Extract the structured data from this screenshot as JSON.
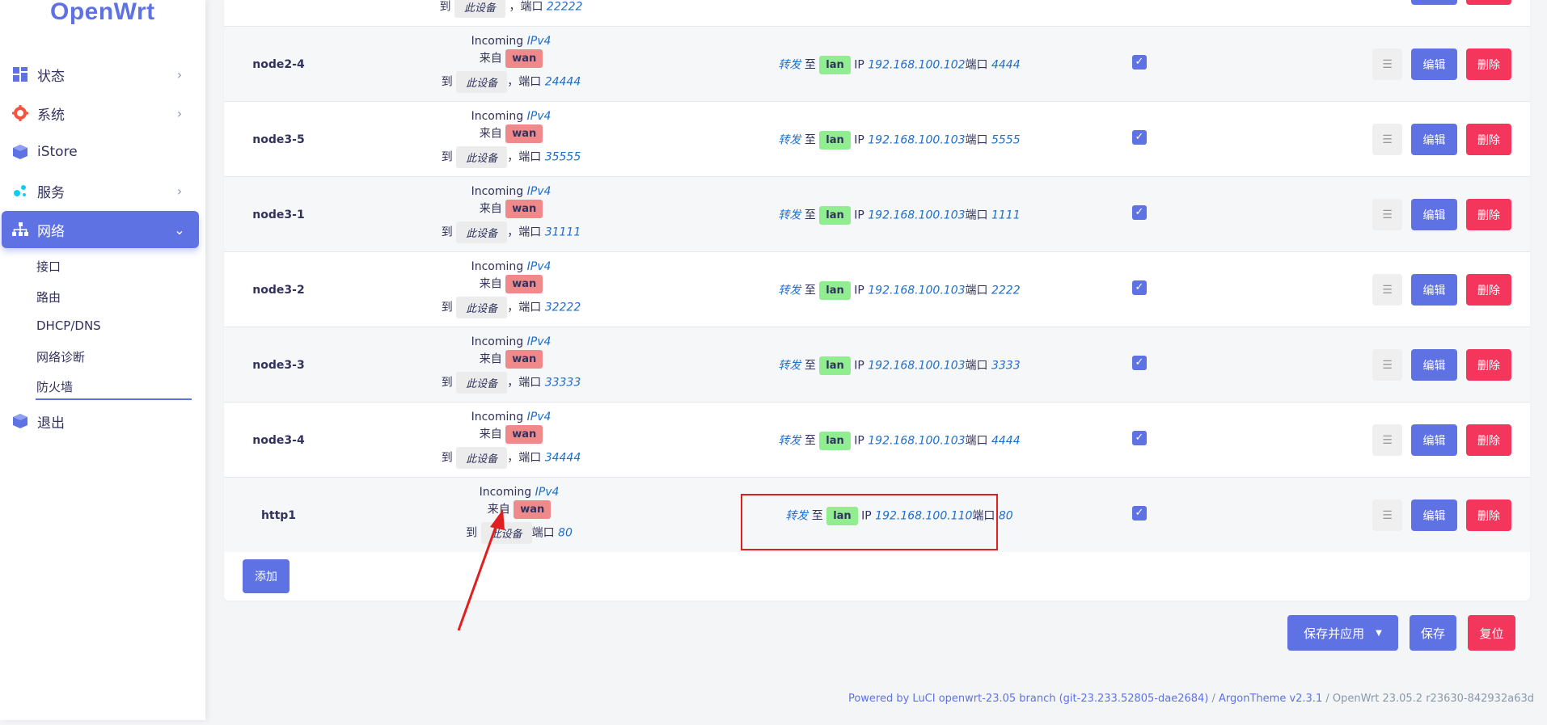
{
  "brand": "OpenWrt",
  "nav": [
    {
      "label": "状态",
      "icon": "dashboard-icon"
    },
    {
      "label": "系统",
      "icon": "gear-icon"
    },
    {
      "label": "iStore",
      "icon": "cube-icon"
    },
    {
      "label": "服务",
      "icon": "cubes-icon"
    },
    {
      "label": "网络",
      "icon": "network-icon"
    }
  ],
  "subnav": [
    "接口",
    "路由",
    "DHCP/DNS",
    "网络诊断",
    "防火墙"
  ],
  "logout": "退出",
  "top_partial": {
    "to": "到",
    "device": "此设备",
    "port_text": "，端口",
    "port": "22222"
  },
  "rows": [
    {
      "name": "node2-4",
      "incoming": "Incoming",
      "ipv": "IPv4",
      "from": "来自",
      "zone": "wan",
      "to": "到",
      "device": "此设备",
      "port_text": "，端口",
      "port": "24444",
      "action": "转发",
      "to2": "至",
      "dst_zone": "lan",
      "ip_text": "IP",
      "ip": "192.168.100.102",
      "dport_text": "端口",
      "dport": "4444"
    },
    {
      "name": "node3-5",
      "incoming": "Incoming",
      "ipv": "IPv4",
      "from": "来自",
      "zone": "wan",
      "to": "到",
      "device": "此设备",
      "port_text": "，端口",
      "port": "35555",
      "action": "转发",
      "to2": "至",
      "dst_zone": "lan",
      "ip_text": "IP",
      "ip": "192.168.100.103",
      "dport_text": "端口",
      "dport": "5555"
    },
    {
      "name": "node3-1",
      "incoming": "Incoming",
      "ipv": "IPv4",
      "from": "来自",
      "zone": "wan",
      "to": "到",
      "device": "此设备",
      "port_text": "，端口",
      "port": "31111",
      "action": "转发",
      "to2": "至",
      "dst_zone": "lan",
      "ip_text": "IP",
      "ip": "192.168.100.103",
      "dport_text": "端口",
      "dport": "1111"
    },
    {
      "name": "node3-2",
      "incoming": "Incoming",
      "ipv": "IPv4",
      "from": "来自",
      "zone": "wan",
      "to": "到",
      "device": "此设备",
      "port_text": "，端口",
      "port": "32222",
      "action": "转发",
      "to2": "至",
      "dst_zone": "lan",
      "ip_text": "IP",
      "ip": "192.168.100.103",
      "dport_text": "端口",
      "dport": "2222"
    },
    {
      "name": "node3-3",
      "incoming": "Incoming",
      "ipv": "IPv4",
      "from": "来自",
      "zone": "wan",
      "to": "到",
      "device": "此设备",
      "port_text": "，端口",
      "port": "33333",
      "action": "转发",
      "to2": "至",
      "dst_zone": "lan",
      "ip_text": "IP",
      "ip": "192.168.100.103",
      "dport_text": "端口",
      "dport": "3333"
    },
    {
      "name": "node3-4",
      "incoming": "Incoming",
      "ipv": "IPv4",
      "from": "来自",
      "zone": "wan",
      "to": "到",
      "device": "此设备",
      "port_text": "，端口",
      "port": "34444",
      "action": "转发",
      "to2": "至",
      "dst_zone": "lan",
      "ip_text": "IP",
      "ip": "192.168.100.103",
      "dport_text": "端口",
      "dport": "4444"
    },
    {
      "name": "http1",
      "incoming": "Incoming",
      "ipv": "IPv4",
      "from": "来自",
      "zone": "wan",
      "to": "到",
      "device": "此设备",
      "port_text": "端口",
      "port": "80",
      "action": "转发",
      "to2": "至",
      "dst_zone": "lan",
      "ip_text": "IP",
      "ip": "192.168.100.110",
      "dport_text": "端口",
      "dport": "80"
    }
  ],
  "buttons": {
    "drag": "☰",
    "edit": "编辑",
    "delete": "删除",
    "add": "添加",
    "save_apply": "保存并应用",
    "save": "保存",
    "reset": "复位"
  },
  "footer": {
    "powered": "Powered by LuCI openwrt-23.05 branch (git-23.233.52805-dae2684)",
    "sep1": " / ",
    "theme": "ArgonTheme v2.3.1",
    "sep2": " / ",
    "version": "OpenWrt 23.05.2 r23630-842932a63d"
  },
  "colors": {
    "primary": "#5e72e4",
    "danger": "#f5365c",
    "wan": "#f08a8a",
    "lan": "#90ee90",
    "highlight": "#e02020"
  }
}
